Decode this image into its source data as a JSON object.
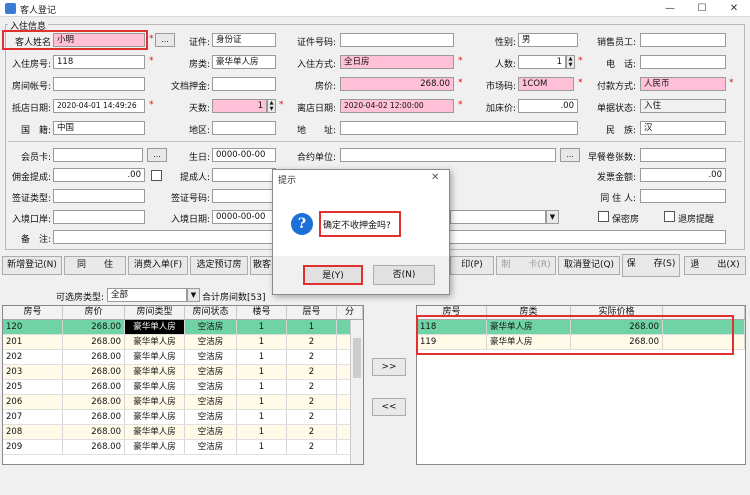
{
  "window": {
    "title": "客人登记",
    "minimize": "—",
    "maximize": "☐",
    "close": "✕"
  },
  "group_title": "入住信息",
  "form": {
    "guest_name": {
      "label": "客人姓名",
      "value": "小明",
      "btn": "..."
    },
    "id_type": {
      "label": "证件:",
      "value": "身份证"
    },
    "id_number": {
      "label": "证件号码:",
      "value": ""
    },
    "gender": {
      "label": "性别:",
      "value": "男"
    },
    "sales": {
      "label": "销售员工:",
      "value": ""
    },
    "room_no": {
      "label": "入住房号:",
      "value": "118"
    },
    "room_type": {
      "label": "房类:",
      "value": "豪华单人房"
    },
    "checkin_mode": {
      "label": "入住方式:",
      "value": "全日房"
    },
    "people": {
      "label": "人数:",
      "value": "1"
    },
    "phone": {
      "label": "电　话:",
      "value": ""
    },
    "room_account": {
      "label": "房间帐号:",
      "value": ""
    },
    "deposit": {
      "label": "文档押金:",
      "value": ""
    },
    "price": {
      "label": "房价:",
      "value": "268.00"
    },
    "market_code": {
      "label": "市场码:",
      "value": "1COM"
    },
    "payment": {
      "label": "付款方式:",
      "value": "人民币"
    },
    "arrival": {
      "label": "抵店日期:",
      "value": "2020-04-01 14:49:26"
    },
    "days": {
      "label": "天数:",
      "value": "1"
    },
    "departure": {
      "label": "离店日期:",
      "value": "2020-04-02 12:00:00"
    },
    "extra_price": {
      "label": "加床价:",
      "value": ".00"
    },
    "status": {
      "label": "单据状态:",
      "value": "入住"
    },
    "nationality": {
      "label": "国　籍:",
      "value": "中国"
    },
    "region": {
      "label": "地区:",
      "value": ""
    },
    "address": {
      "label": "地　　址:",
      "value": ""
    },
    "ethnicity": {
      "label": "民　族:",
      "value": "汉"
    },
    "member_card": {
      "label": "会员卡:",
      "value": ""
    },
    "birthday": {
      "label": "生日:",
      "value": "0000-00-00"
    },
    "contract_unit": {
      "label": "合约单位:",
      "value": ""
    },
    "breakfast": {
      "label": "早餐卷张数:",
      "value": ""
    },
    "commission": {
      "label": "佣金提成:",
      "value": ".00"
    },
    "referrer": {
      "label": "提成人:",
      "value": ""
    },
    "invoice": {
      "label": "发票金额:",
      "value": ".00"
    },
    "visa_type": {
      "label": "签证类型:",
      "value": ""
    },
    "companion": {
      "label": "同 住 人:",
      "value": ""
    },
    "visa_no": {
      "label": "签证号码:",
      "value": ""
    },
    "entry_port": {
      "label": "入境口岸:",
      "value": ""
    },
    "entry_date": {
      "label": "入境日期:",
      "value": "0000-00-00"
    },
    "confidential": {
      "label": "保密房"
    },
    "checkout_alert": {
      "label": "退房提醒"
    },
    "remark": {
      "label": "备　注:",
      "value": ""
    }
  },
  "toolbar": {
    "new": "新增登记(N)",
    "same_room": "同　　住",
    "consume": "消费入单(F)",
    "select_reserve": "选定预订房",
    "reserve_short": "散客",
    "print": "印(P)",
    "card": "制　　卡(R)",
    "cancel": "取消登记(Q)",
    "save": "保　　存(S)",
    "exit": "退　　出(X)"
  },
  "room_filter": {
    "label": "可选房类型:",
    "value": "全部",
    "count": "合计房间数[53]"
  },
  "left_grid": {
    "headers": [
      "房号",
      "房价",
      "房间类型",
      "房间状态",
      "楼号",
      "层号",
      "分"
    ],
    "rows": [
      [
        "120",
        "268.00",
        "豪华单人房",
        "空洁房",
        "1",
        "1"
      ],
      [
        "201",
        "268.00",
        "豪华单人房",
        "空洁房",
        "1",
        "2"
      ],
      [
        "202",
        "268.00",
        "豪华单人房",
        "空洁房",
        "1",
        "2"
      ],
      [
        "203",
        "268.00",
        "豪华单人房",
        "空洁房",
        "1",
        "2"
      ],
      [
        "205",
        "268.00",
        "豪华单人房",
        "空洁房",
        "1",
        "2"
      ],
      [
        "206",
        "268.00",
        "豪华单人房",
        "空洁房",
        "1",
        "2"
      ],
      [
        "207",
        "268.00",
        "豪华单人房",
        "空洁房",
        "1",
        "2"
      ],
      [
        "208",
        "268.00",
        "豪华单人房",
        "空洁房",
        "1",
        "2"
      ],
      [
        "209",
        "268.00",
        "豪华单人房",
        "空洁房",
        "1",
        "2"
      ]
    ]
  },
  "move_right": ">>",
  "move_left": "<<",
  "right_grid": {
    "headers": [
      "房号",
      "房类",
      "实际价格"
    ],
    "rows": [
      [
        "118",
        "豪华单人房",
        "268.00"
      ],
      [
        "119",
        "豪华单人房",
        "268.00"
      ]
    ]
  },
  "dialog": {
    "title": "提示",
    "message": "确定不收押金吗?",
    "yes": "是(Y)",
    "no": "否(N)",
    "close": "✕",
    "icon": "?"
  },
  "colors": {
    "pink": "#ffc0d8",
    "selected_row": "#6fd3a6",
    "highlight": "#e03030"
  }
}
